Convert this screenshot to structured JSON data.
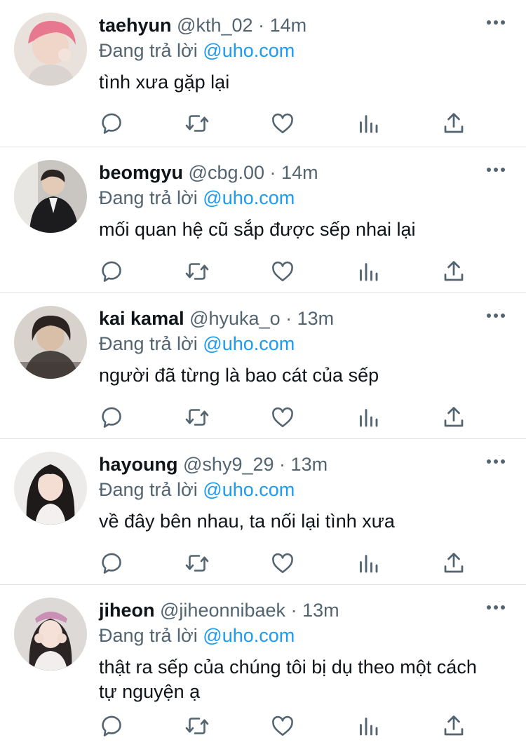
{
  "colors": {
    "link": "#1d9bf0",
    "muted": "#536471",
    "text": "#0f1419",
    "divider": "#dfe3e6"
  },
  "icons": {
    "more": "more-horizontal-icon",
    "reply": "reply-icon",
    "retweet": "retweet-icon",
    "like": "heart-icon",
    "stats": "stats-icon",
    "share": "share-icon"
  },
  "tweets": [
    {
      "name": "taehyun",
      "handle": "@kth_02",
      "dot": "·",
      "time": "14m",
      "reply_prefix": "Đang trả lời",
      "reply_to": "@uho.com",
      "text": "tình xưa gặp lại"
    },
    {
      "name": "beomgyu",
      "handle": "@cbg.00",
      "dot": "·",
      "time": "14m",
      "reply_prefix": "Đang trả lời",
      "reply_to": "@uho.com",
      "text": "mối quan hệ cũ sắp được sếp nhai lại"
    },
    {
      "name": "kai kamal",
      "handle": "@hyuka_o",
      "dot": "·",
      "time": "13m",
      "reply_prefix": "Đang trả lời",
      "reply_to": "@uho.com",
      "text": "người đã từng là bao cát của sếp"
    },
    {
      "name": "hayoung",
      "handle": "@shy9_29",
      "dot": "·",
      "time": "13m",
      "reply_prefix": "Đang trả lời",
      "reply_to": "@uho.com",
      "text": "về đây bên nhau, ta nối lại tình xưa"
    },
    {
      "name": "jiheon",
      "handle": "@jiheonnibaek",
      "dot": "·",
      "time": "13m",
      "reply_prefix": "Đang trả lời",
      "reply_to": "@uho.com",
      "text": "thật ra sếp của chúng tôi bị dụ theo một cách tự nguyện ạ"
    }
  ]
}
